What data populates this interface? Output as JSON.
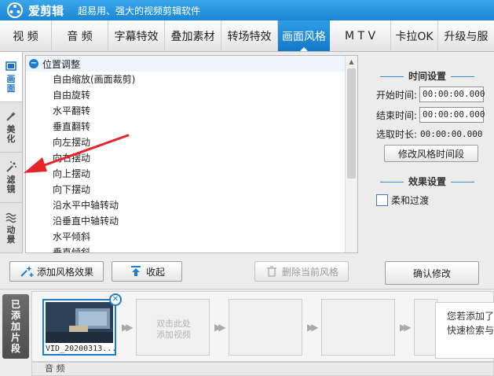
{
  "titlebar": {
    "app_name": "爱剪辑",
    "slogan": "超易用、强大的视频剪辑软件"
  },
  "menu": [
    {
      "label": "视 频",
      "active": false
    },
    {
      "label": "音 频",
      "active": false
    },
    {
      "label": "字幕特效",
      "active": false
    },
    {
      "label": "叠加素材",
      "active": false
    },
    {
      "label": "转场特效",
      "active": false
    },
    {
      "label": "画面风格",
      "active": true
    },
    {
      "label": "M T V",
      "active": false
    },
    {
      "label": "卡拉OK",
      "active": false
    },
    {
      "label": "升级与服",
      "active": false
    }
  ],
  "side_tabs": [
    {
      "label": "画面",
      "active": true
    },
    {
      "label": "美化",
      "active": false
    },
    {
      "label": "滤镜",
      "active": false
    },
    {
      "label": "动景",
      "active": false
    }
  ],
  "effect_list": {
    "group": "位置调整",
    "collapse_symbol": "−",
    "items": [
      "自由缩放(画面裁剪)",
      "自由旋转",
      "水平翻转",
      "垂直翻转",
      "向左摆动",
      "向右摆动",
      "向上摆动",
      "向下摆动",
      "沿水平中轴转动",
      "沿垂直中轴转动",
      "水平倾斜",
      "垂直倾斜"
    ]
  },
  "time_settings": {
    "title": "时间设置",
    "start_label": "开始时间:",
    "start_value": "00:00:00.000",
    "end_label": "结束时间:",
    "end_value": "00:00:00.000",
    "duration_label": "选取时长:",
    "duration_value": "00:00:00.000",
    "modify_button": "修改风格时间段"
  },
  "effect_settings": {
    "title": "效果设置",
    "soft_transition_label": "柔和过渡",
    "soft_transition_checked": false
  },
  "buttons": {
    "add_effect": "添加风格效果",
    "collapse": "收起",
    "delete_current": "删除当前风格",
    "confirm": "确认修改"
  },
  "clips": {
    "tab_label": "已添加片段",
    "clip_name": "VID_20200313...",
    "empty_hint_1": "双击此处",
    "empty_hint_2": "添加视频",
    "audio_label": "音 频"
  },
  "tooltip": {
    "line1": "您若添加了",
    "line2": "快速检索与"
  },
  "colors": {
    "accent": "#1d7cd0",
    "annotation_arrow": "#e8242a"
  }
}
